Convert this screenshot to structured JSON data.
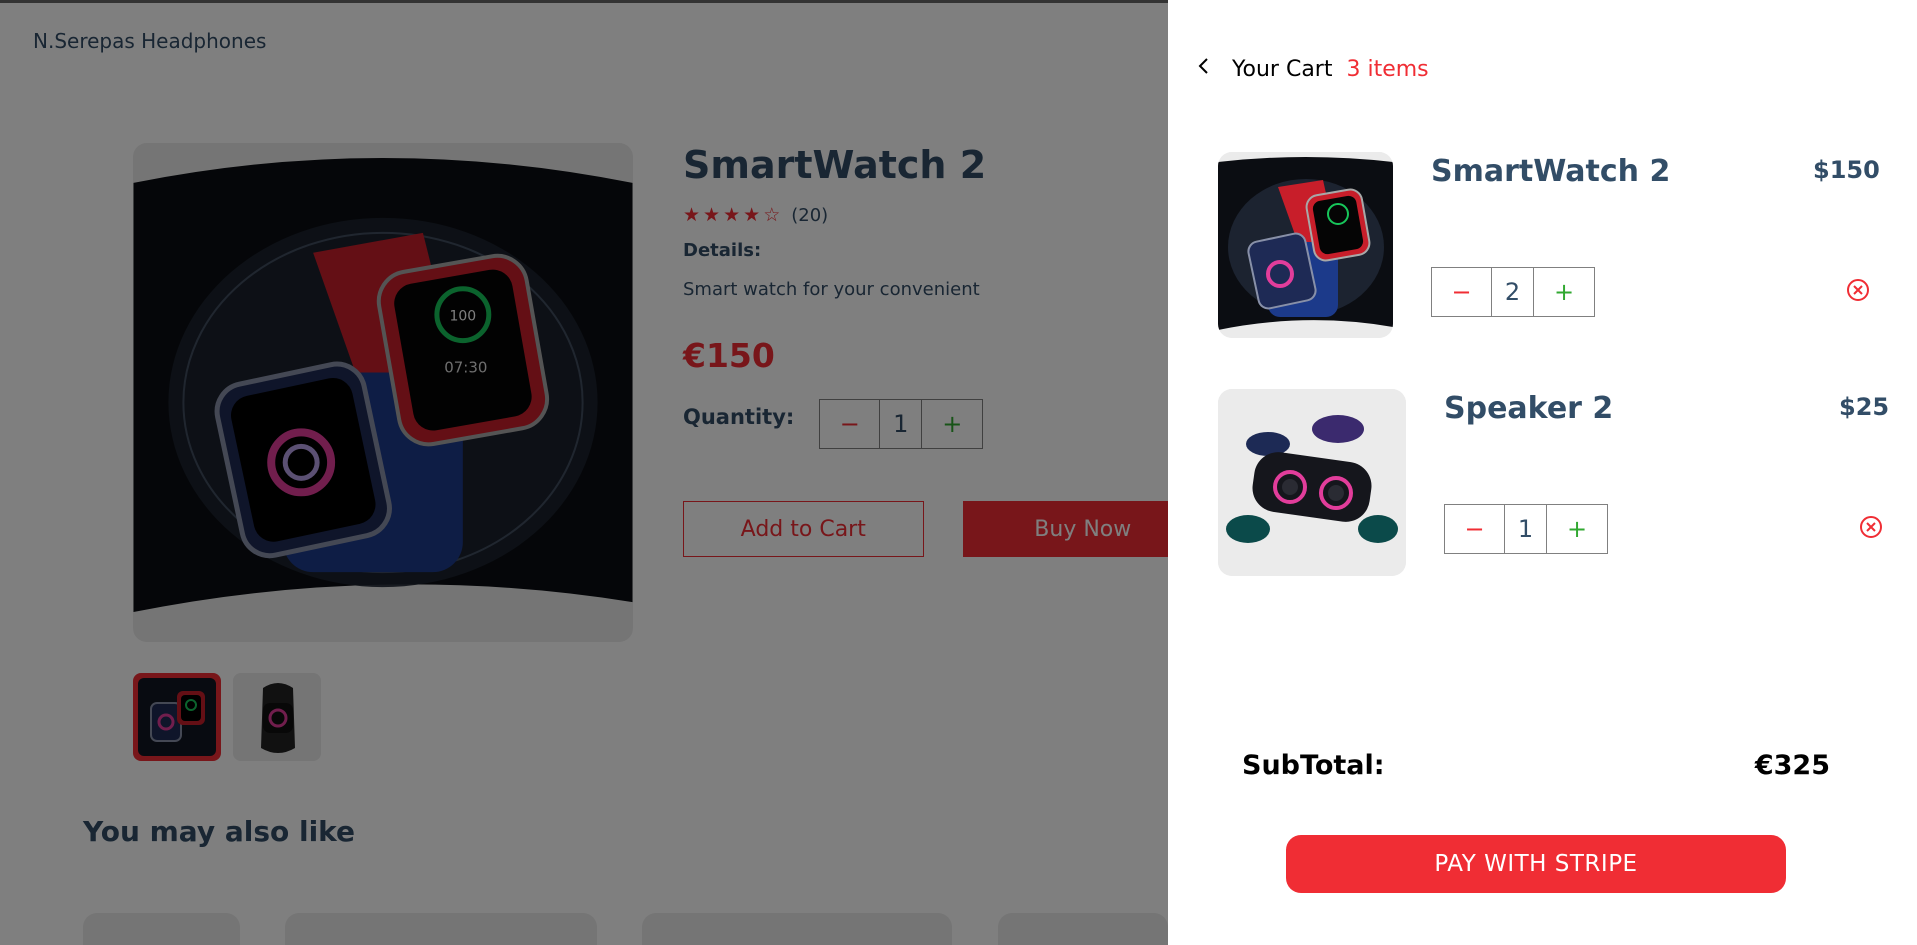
{
  "page": {
    "brand": "N.Serepas Headphones",
    "product": {
      "title": "SmartWatch 2",
      "rating_stars": 4,
      "rating_max": 5,
      "reviews": "(20)",
      "details_heading": "Details:",
      "details_text": "Smart watch for your convenient",
      "price": "€150",
      "quantity_label": "Quantity:",
      "quantity_value": "1",
      "minus_symbol": "−",
      "plus_symbol": "+",
      "add_to_cart_label": "Add to Cart",
      "buy_now_label": "Buy Now"
    },
    "also_like_title": "You may also like"
  },
  "cart": {
    "back_icon": "chevron-left-icon",
    "title": "Your Cart",
    "count": "3 items",
    "items": [
      {
        "name": "SmartWatch 2",
        "price": "$150",
        "quantity": "2",
        "minus": "−",
        "plus": "+",
        "remove_icon": "close-circle-icon"
      },
      {
        "name": "Speaker 2",
        "price": "$25",
        "quantity": "1",
        "minus": "−",
        "plus": "+",
        "remove_icon": "close-circle-icon"
      }
    ],
    "subtotal_label": "SubTotal:",
    "subtotal_value": "€325",
    "pay_label": "PAY WITH STRIPE"
  },
  "colors": {
    "accent": "#f02d34",
    "text": "#324d67",
    "plus": "#31a831",
    "image_bg": "#ebebeb"
  }
}
